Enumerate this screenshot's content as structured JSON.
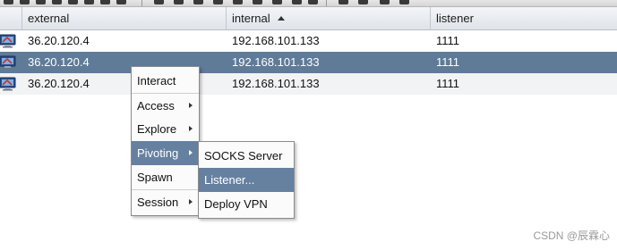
{
  "table": {
    "columns": [
      "",
      "external",
      "internal",
      "listener"
    ],
    "sort_column": "internal",
    "rows": [
      {
        "external": "36.20.120.4",
        "internal": "192.168.101.133",
        "listener": "1111",
        "selected": false
      },
      {
        "external": "36.20.120.4",
        "internal": "192.168.101.133",
        "listener": "1111",
        "selected": true
      },
      {
        "external": "36.20.120.4",
        "internal": "192.168.101.133",
        "listener": "1111",
        "selected": false
      }
    ]
  },
  "context_menu": {
    "items": [
      "Interact",
      "Access",
      "Explore",
      "Pivoting",
      "Spawn",
      "Session"
    ],
    "active": "Pivoting"
  },
  "pivoting_submenu": {
    "items": [
      "SOCKS Server",
      "Listener...",
      "Deploy VPN"
    ],
    "active": "Listener..."
  },
  "watermark": "CSDN @辰霖心",
  "colors": {
    "selection": "#5f7b98",
    "menu_highlight": "#6680a0",
    "header_bg": "#e6eaef"
  },
  "icons": {
    "host": "computer-host-icon",
    "submenu": "chevron-right-icon",
    "sort": "sort-ascending-icon"
  }
}
